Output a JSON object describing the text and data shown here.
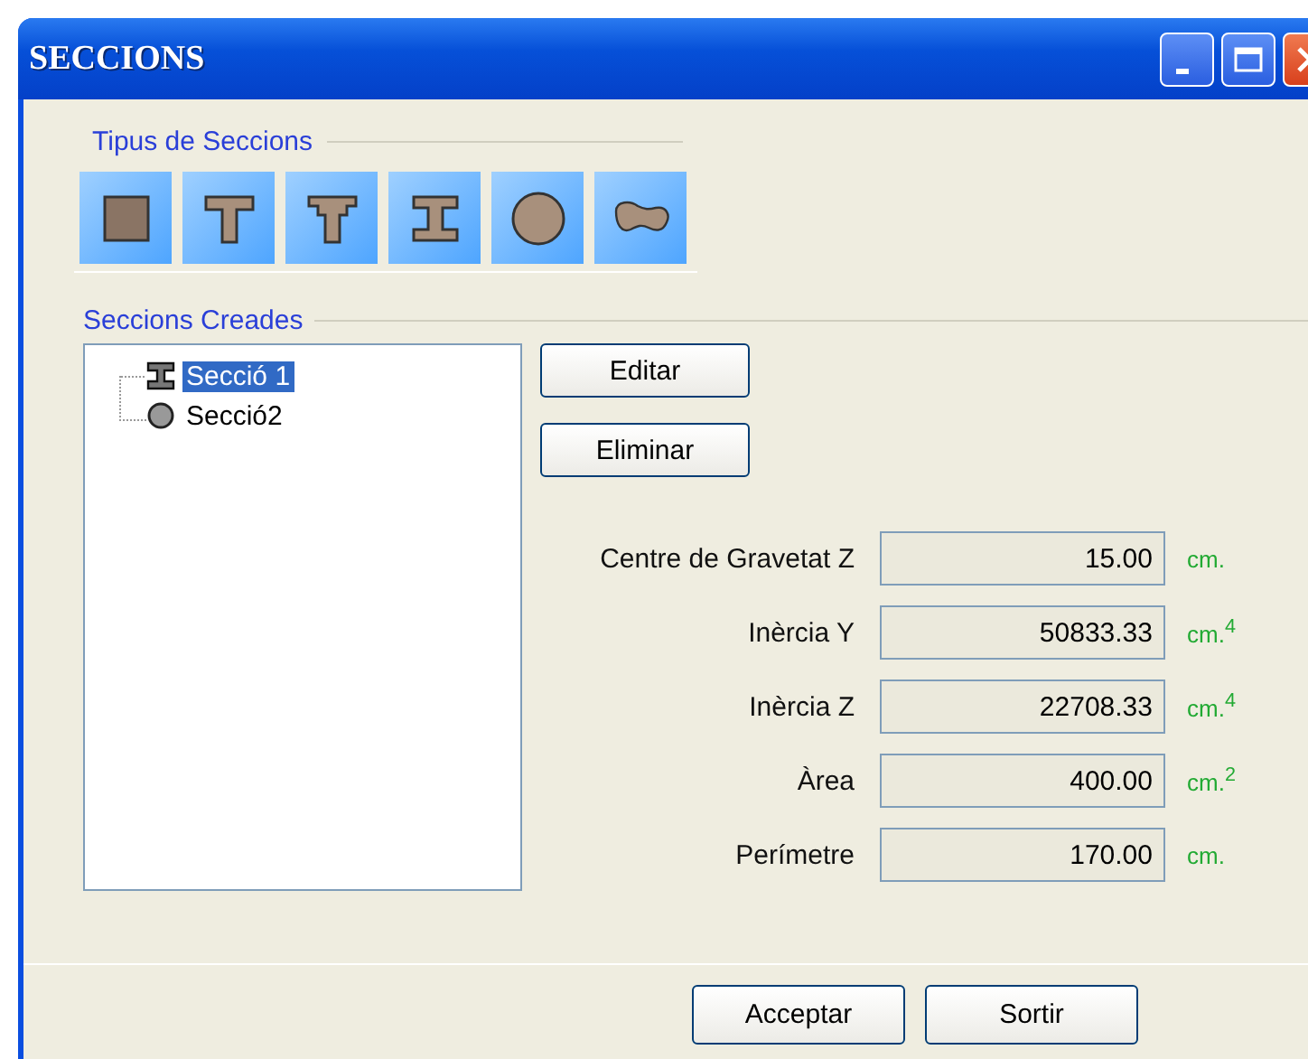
{
  "window": {
    "title": "SECCIONS"
  },
  "section_types": {
    "label": "Tipus de Seccions",
    "items": [
      {
        "kind": "square"
      },
      {
        "kind": "tee"
      },
      {
        "kind": "stepped-tee"
      },
      {
        "kind": "ibeam"
      },
      {
        "kind": "circle"
      },
      {
        "kind": "blob"
      }
    ]
  },
  "created_sections": {
    "label": "Seccions Creades",
    "items": [
      {
        "label": "Secció 1",
        "kind": "ibeam",
        "selected": true
      },
      {
        "label": "Secció2",
        "kind": "circle",
        "selected": false
      }
    ]
  },
  "actions": [
    "Editar",
    "Eliminar"
  ],
  "properties": [
    {
      "label": "Centre de Gravetat Z",
      "value": "15.00",
      "unit": "cm."
    },
    {
      "label": "Inèrcia Y",
      "value": "50833.33",
      "unit": "cm.$^{4}$"
    },
    {
      "label": "Inèrcia Z",
      "value": "22708.33",
      "unit": "cm.$^{4}$"
    },
    {
      "label": "Àrea",
      "value": "400.00",
      "unit": "cm.$^{2}$"
    },
    {
      "label": "Perímetre",
      "value": "170.00",
      "unit": "cm."
    }
  ],
  "buttons": [
    "Acceptar",
    "Sortir"
  ]
}
